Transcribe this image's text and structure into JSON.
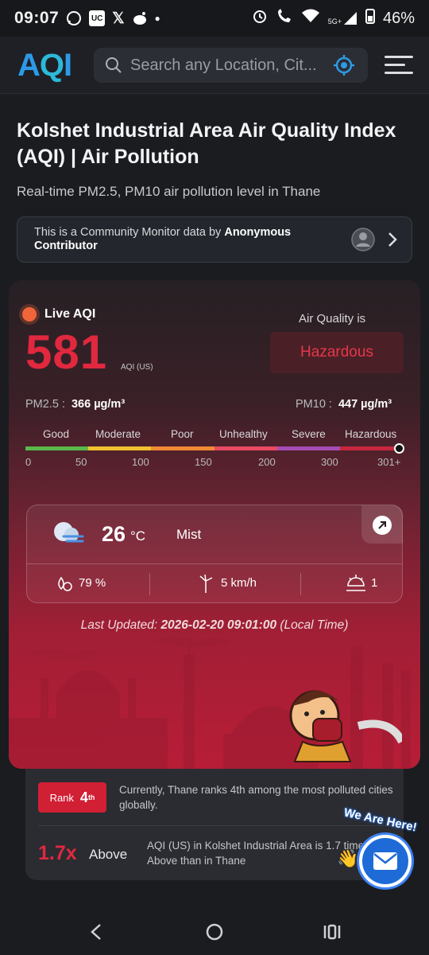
{
  "status_bar": {
    "time": "09:07",
    "network": "5G+",
    "battery": "46%"
  },
  "header": {
    "logo": "AQI",
    "search_placeholder": "Search any Location, Cit..."
  },
  "page": {
    "title": "Kolshet Industrial Area Air Quality Index (AQI) | Air Pollution",
    "subtitle": "Real-time PM2.5, PM10 air pollution level in Thane",
    "community_prefix": "This is a Community Monitor data by ",
    "community_contributor": "Anonymous Contributor"
  },
  "aqi": {
    "live_label": "Live AQI",
    "value": "581",
    "unit": "AQI (US)",
    "air_quality_label": "Air Quality is",
    "status": "Hazardous",
    "pm25_label": "PM2.5 :",
    "pm25_value": "366 µg/m³",
    "pm10_label": "PM10 :",
    "pm10_value": "447 µg/m³"
  },
  "scale": {
    "labels": [
      "Good",
      "Moderate",
      "Poor",
      "Unhealthy",
      "Severe",
      "Hazardous"
    ],
    "numbers": [
      "0",
      "50",
      "100",
      "150",
      "200",
      "300",
      "301+"
    ],
    "colors": [
      "#59b94a",
      "#f2c12e",
      "#f08a33",
      "#e84a62",
      "#a64cb4",
      "#c7263e"
    ]
  },
  "weather": {
    "temp": "26",
    "temp_unit": "°C",
    "condition": "Mist",
    "humidity": "79 %",
    "wind": "5 km/h",
    "uv": "1",
    "last_updated_prefix": "Last Updated: ",
    "last_updated_value": "2026-02-20 09:01:00",
    "last_updated_suffix": " (Local Time)"
  },
  "ranking": {
    "rank_label": "Rank",
    "rank_value": "4",
    "rank_suffix": "th",
    "rank_text": "Currently, Thane ranks 4th among the most polluted cities globally.",
    "times_value": "1.7x",
    "times_label": "Above",
    "compare_text": "AQI (US) in Kolshet Industrial Area is 1.7 times Above than in Thane"
  },
  "chat": {
    "label": "We Are Here!"
  },
  "colors": {
    "accent_red": "#e0283f",
    "brand_blue": "#2d9ae6"
  }
}
